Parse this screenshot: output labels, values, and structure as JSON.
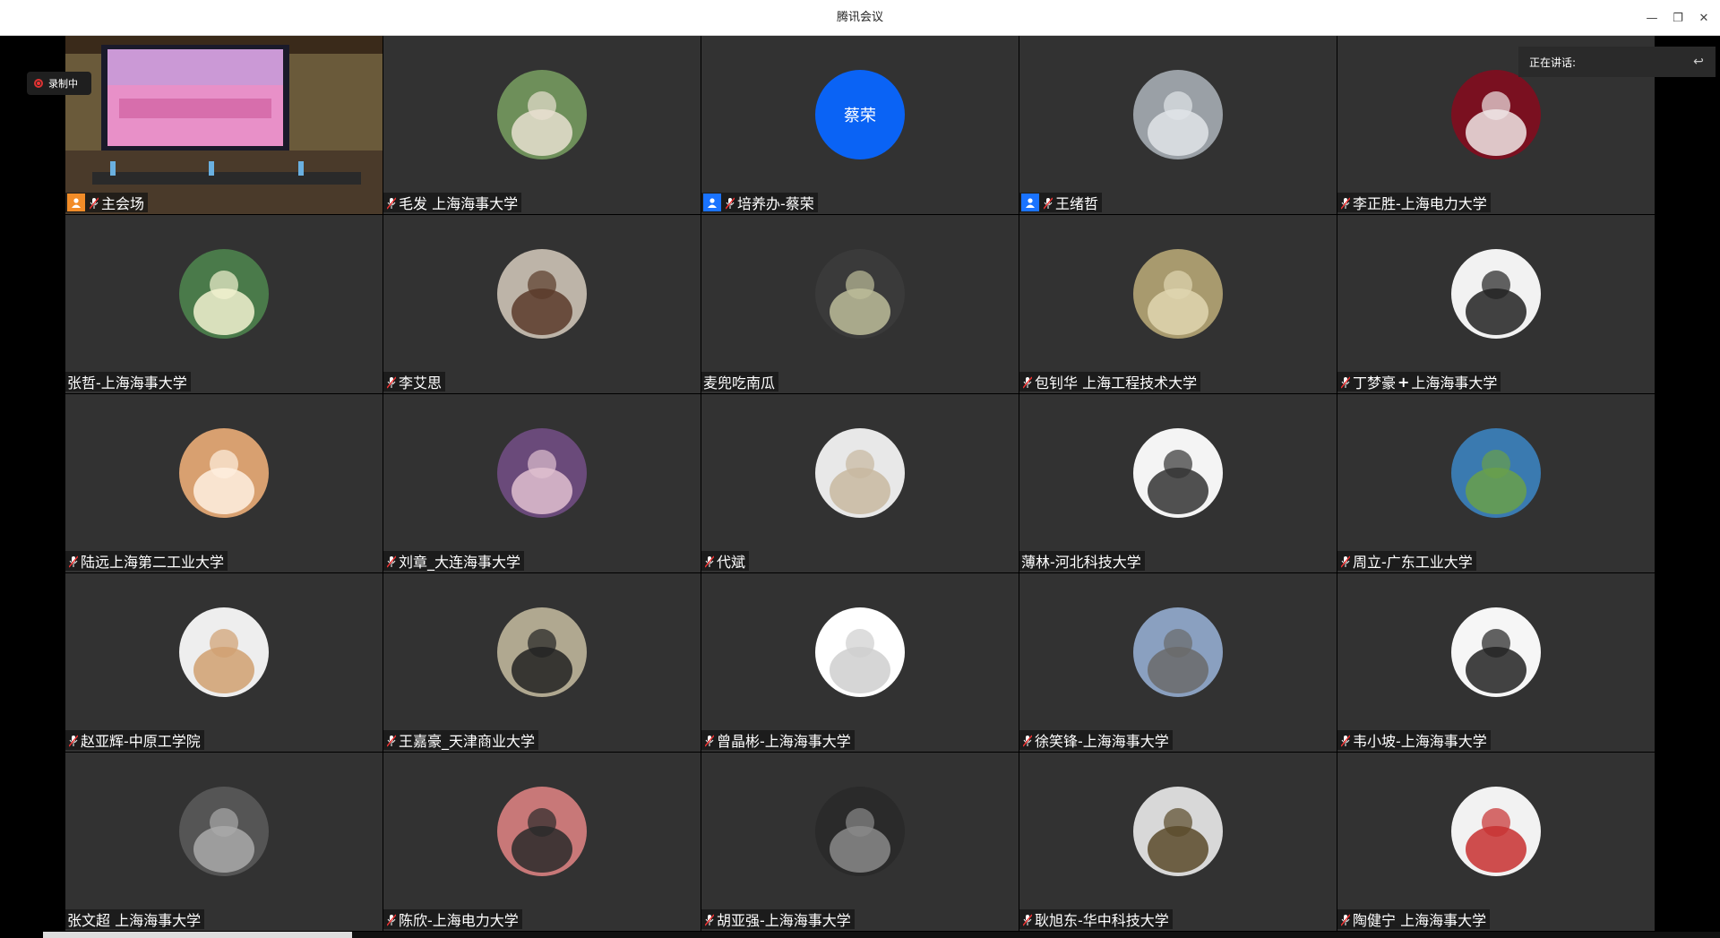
{
  "window": {
    "title": "腾讯会议",
    "minimize": "—",
    "restore": "❐",
    "close": "✕"
  },
  "recording": {
    "label": "录制中"
  },
  "speaking": {
    "label": "正在讲话:"
  },
  "tiles": [
    {
      "name": "主会场",
      "type": "video",
      "badge": "host-orange",
      "mic": true
    },
    {
      "name": "毛发 上海海事大学",
      "type": "photo",
      "mic": true
    },
    {
      "name": "培养办-蔡荣",
      "type": "text",
      "avatar_text": "蔡荣",
      "badge": "host-blue",
      "mic": true
    },
    {
      "name": "王绪哲",
      "type": "photo",
      "badge": "host-blue",
      "mic": true
    },
    {
      "name": "李正胜-上海电力大学",
      "type": "photo",
      "mic": true
    },
    {
      "name": "张哲-上海海事大学",
      "type": "photo",
      "mic": false
    },
    {
      "name": "李艾思",
      "type": "photo",
      "mic": true
    },
    {
      "name": "麦兜吃南瓜",
      "type": "photo",
      "mic": false
    },
    {
      "name": "包钊华 上海工程技术大学",
      "type": "photo",
      "mic": true
    },
    {
      "name": "丁梦豪",
      "suffix": "上海海事大学",
      "type": "photo",
      "mic": true,
      "plus": true
    },
    {
      "name": "陆远上海第二工业大学",
      "type": "photo",
      "mic": true
    },
    {
      "name": "刘章_大连海事大学",
      "type": "photo",
      "mic": true
    },
    {
      "name": "代斌",
      "type": "photo",
      "mic": true
    },
    {
      "name": "薄林-河北科技大学",
      "type": "photo",
      "mic": false
    },
    {
      "name": "周立-广东工业大学",
      "type": "photo",
      "mic": true
    },
    {
      "name": "赵亚辉-中原工学院",
      "type": "photo",
      "mic": true
    },
    {
      "name": "王嘉豪_天津商业大学",
      "type": "photo",
      "mic": true
    },
    {
      "name": "曾晶彬-上海海事大学",
      "type": "photo",
      "mic": true
    },
    {
      "name": "徐笑锋-上海海事大学",
      "type": "photo",
      "mic": true
    },
    {
      "name": "韦小坡-上海海事大学",
      "type": "photo",
      "mic": true
    },
    {
      "name": "张文超 上海海事大学",
      "type": "photo",
      "mic": false
    },
    {
      "name": "陈欣-上海电力大学",
      "type": "photo",
      "mic": true
    },
    {
      "name": "胡亚强-上海海事大学",
      "type": "photo",
      "mic": true
    },
    {
      "name": "耿旭东-华中科技大学",
      "type": "photo",
      "mic": true
    },
    {
      "name": "陶健宁 上海海事大学",
      "type": "photo",
      "mic": true
    }
  ],
  "colors": {
    "tile_bg": "#323232",
    "accent_blue": "#0a63f5",
    "host_orange": "#f28c28",
    "rec_red": "#e33"
  }
}
